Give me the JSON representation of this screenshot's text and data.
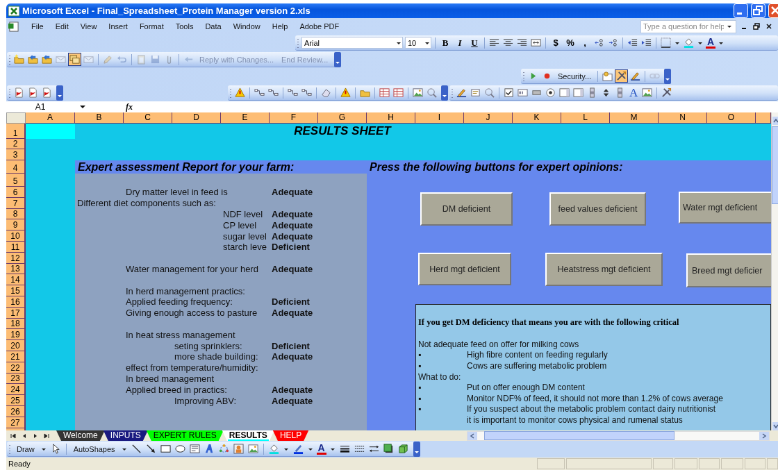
{
  "window": {
    "title": "Microsoft Excel - Final_Spreadsheet_Protein Manager version 2.xls"
  },
  "menu": [
    "File",
    "Edit",
    "View",
    "Insert",
    "Format",
    "Tools",
    "Data",
    "Window",
    "Help",
    "Adobe PDF"
  ],
  "help_search": {
    "placeholder": "Type a question for help"
  },
  "formatting_toolbar": {
    "font": "Arial",
    "size": "10",
    "style_buttons": [
      "B",
      "I",
      "U"
    ],
    "number_buttons": [
      "$",
      "%",
      ","
    ],
    "font_color_label": "A"
  },
  "reviewing_toolbar": {
    "buttons": [
      {
        "kind": "button",
        "pressed": false,
        "disabled": false
      },
      {
        "kind": "button",
        "pressed": false,
        "disabled": false
      },
      {
        "kind": "button",
        "pressed": false,
        "disabled": false
      },
      {
        "kind": "button",
        "pressed": false,
        "disabled": true
      },
      {
        "kind": "button",
        "pressed": true,
        "disabled": false
      },
      {
        "kind": "button",
        "pressed": false,
        "disabled": true
      },
      {
        "kind": "separator"
      },
      {
        "kind": "button",
        "pressed": false,
        "disabled": true
      },
      {
        "kind": "button",
        "pressed": false,
        "disabled": true
      },
      {
        "kind": "separator"
      },
      {
        "kind": "button",
        "pressed": false,
        "disabled": true
      },
      {
        "kind": "button",
        "pressed": false,
        "disabled": true
      },
      {
        "kind": "button",
        "pressed": false,
        "disabled": true
      },
      {
        "kind": "separator"
      }
    ],
    "reply": "Reply with Changes...",
    "end_review": "End Review...",
    "text_disabled": true
  },
  "security_toolbar": {
    "label": "Security...",
    "buttons": [
      {
        "pressed": false,
        "disabled": false
      },
      {
        "pressed": true,
        "disabled": false
      },
      {
        "pressed": false,
        "disabled": false
      },
      {
        "pressed": false,
        "disabled": true
      }
    ]
  },
  "forms_toolbar": {
    "label_tool": "A"
  },
  "formula_bar": {
    "name_box": "A1",
    "function_label": "fx"
  },
  "columns": [
    "A",
    "B",
    "C",
    "D",
    "E",
    "F",
    "G",
    "H",
    "I",
    "J",
    "K",
    "L",
    "M",
    "N",
    "O"
  ],
  "rows": [
    "1",
    "2",
    "3",
    "4",
    "5",
    "6",
    "7",
    "8",
    "9",
    "10",
    "11",
    "12",
    "13",
    "14",
    "15",
    "16",
    "17",
    "18",
    "19",
    "20",
    "21",
    "22",
    "23",
    "24",
    "25",
    "26",
    "27"
  ],
  "sheet": {
    "title": "RESULTS SHEET",
    "report_heading": "Expert assessment Report for your farm:",
    "buttons_heading": "Press the following buttons for expert opinions:",
    "report_lines": [
      {
        "label": "Dry matter level in feed is",
        "value": "Adequate"
      },
      {
        "label": "Different diet components such as:"
      },
      {
        "label": "NDF level",
        "value": "Adequate"
      },
      {
        "label": "CP level",
        "value": "Adequate"
      },
      {
        "label": "sugar level",
        "value": "Adequate"
      },
      {
        "label": "starch leve",
        "value": "Deficient"
      },
      {
        "label": "Water management for your herd",
        "value": "Adequate"
      },
      {
        "label": "In herd management practics:"
      },
      {
        "label": "Applied feeding frequency:",
        "value": "Deficient"
      },
      {
        "label": "Giving enough access to pasture",
        "value": "Adequate"
      },
      {
        "label": "In heat stress management"
      },
      {
        "label": "seting sprinklers:",
        "value": "Deficient"
      },
      {
        "label": "more shade building:",
        "value": "Adequate"
      },
      {
        "label": "effect from temperature/humidity:"
      },
      {
        "label": "In breed management"
      },
      {
        "label": "Applied breed in practics:",
        "value": "Adequate"
      },
      {
        "label": "Improving ABV:",
        "value": "Adequate"
      }
    ],
    "opinion_buttons": [
      "DM deficient",
      "feed values deficient",
      "Water mgt deficient",
      "Herd mgt deficient",
      "Heatstress mgt deficient",
      "Breed mgt deficier"
    ],
    "text_box": {
      "heading": "If you get DM deficiency that means you are with the following critical",
      "lines": [
        {
          "kind": "text",
          "text": "Not adequate feed on offer for milking cows"
        },
        {
          "kind": "bullet",
          "bullet": "▪",
          "text": "High fibre content on feeding regularly"
        },
        {
          "kind": "bullet",
          "bullet": "▪",
          "text": "Cows are suffering metabolic problem"
        },
        {
          "kind": "text",
          "text": "What to do:"
        },
        {
          "kind": "bullet",
          "bullet": "▪",
          "text": "Put on offer enough DM content"
        },
        {
          "kind": "bullet",
          "bullet": "▪",
          "text": "Monitor NDF% of feed, it should not more than 1.2% of cows average"
        },
        {
          "kind": "bullet",
          "bullet": "▪",
          "text": "If you suspect about the metabolic problem contact dairy nutritionist"
        },
        {
          "kind": "continuation",
          "text": "it is important to monitor cows physical and rumenal status"
        }
      ]
    }
  },
  "sheet_tabs": [
    {
      "label": "Welcome",
      "color": "#333333",
      "selected": false
    },
    {
      "label": "INPUTS",
      "color": "#1a1a80",
      "selected": false
    },
    {
      "label": "EXPERT RULES",
      "color": "#00ff00",
      "selected": false
    },
    {
      "label": "RESULTS",
      "color": "#00ffff",
      "selected": true
    },
    {
      "label": "HELP",
      "color": "#ff0000",
      "selected": false
    }
  ],
  "draw_toolbar": {
    "draw": "Draw",
    "autoshapes": "AutoShapes",
    "font_color_label": "A"
  },
  "status_bar": {
    "text": "Ready"
  }
}
